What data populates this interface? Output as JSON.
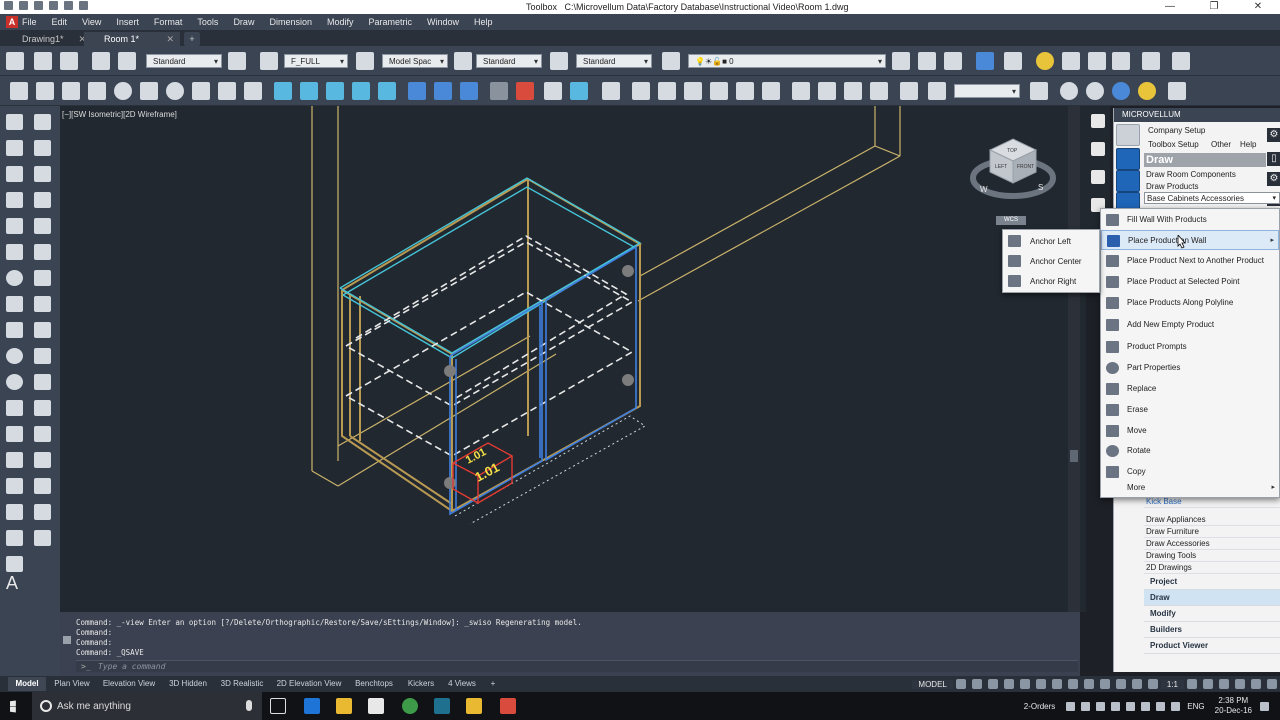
{
  "window": {
    "app_name": "Toolbox",
    "file_path": "C:\\Microvellum Data\\Factory Database\\Instructional Video\\Room 1.dwg"
  },
  "menu": [
    "File",
    "Edit",
    "View",
    "Insert",
    "Format",
    "Tools",
    "Draw",
    "Dimension",
    "Modify",
    "Parametric",
    "Window",
    "Help"
  ],
  "doc_tabs": [
    {
      "label": "Drawing1*",
      "active": false
    },
    {
      "label": "Room 1*",
      "active": true
    }
  ],
  "toolbar": {
    "text_style": "Standard",
    "font": "F_FULL",
    "dim_style": "Model Spac",
    "table_style": "Standard",
    "mleader_style": "Standard",
    "layer": "0"
  },
  "viewport": {
    "label": "[−][SW Isometric][2D Wireframe]",
    "annotation_1": "1.01",
    "annotation_2": "1.01",
    "cube_top": "TOP",
    "cube_left": "LEFT",
    "cube_front": "FRONT",
    "compass_w": "W",
    "compass_s": "S",
    "wcs": "WCS"
  },
  "command": {
    "lines": [
      "Command: _-view Enter an option [?/Delete/Orthographic/Restore/Save/sEttings/Window]: _swiso Regenerating model.",
      "Command:",
      "Command:",
      "Command: _QSAVE"
    ],
    "placeholder": "Type a command"
  },
  "layout_tabs": [
    "Model",
    "Plan View",
    "Elevation View",
    "3D Hidden",
    "3D Realistic",
    "2D Elevation View",
    "Benchtops",
    "Kickers",
    "4 Views"
  ],
  "status": {
    "mode": "MODEL",
    "scale": "1:1"
  },
  "palette": {
    "header": "MICROVELLUM",
    "company_setup": "Company Setup",
    "toolbox_setup": "Toolbox Setup",
    "other": "Other",
    "help": "Help",
    "draw": "Draw",
    "draw_room_components": "Draw Room Components",
    "draw_products": "Draw Products",
    "category": "Base Cabinets Accessories",
    "list": [
      "Kick Base",
      "Draw Appliances",
      "Draw Furniture",
      "Draw Accessories",
      "Drawing Tools",
      "2D Drawings"
    ],
    "sections": [
      "Project",
      "Draw",
      "Modify",
      "Builders",
      "Product Viewer"
    ],
    "selected_section": "Draw"
  },
  "context_menu": [
    {
      "label": "Fill Wall With Products",
      "icon": "grid-icon"
    },
    {
      "label": "Place Product on Wall",
      "icon": "wall-icon",
      "submenu": true,
      "highlighted": true
    },
    {
      "label": "Place Product Next to Another Product",
      "icon": "product-next-icon"
    },
    {
      "label": "Place Product at Selected Point",
      "icon": "crosshair-icon"
    },
    {
      "label": "Place Products Along Polyline",
      "icon": "polyline-icon"
    },
    {
      "label": "Add New Empty Product",
      "icon": "plus-icon"
    },
    {
      "label": "Product Prompts",
      "icon": "document-icon"
    },
    {
      "label": "Part Properties",
      "icon": "gear-icon"
    },
    {
      "label": "Replace",
      "icon": "replace-icon"
    },
    {
      "label": "Erase",
      "icon": "eraser-icon"
    },
    {
      "label": "Move",
      "icon": "move-icon"
    },
    {
      "label": "Rotate",
      "icon": "rotate-icon"
    },
    {
      "label": "Copy",
      "icon": "copy-icon"
    },
    {
      "label": "More",
      "icon": "",
      "submenu": true
    }
  ],
  "submenu": [
    "Anchor Left",
    "Anchor Center",
    "Anchor Right"
  ],
  "taskbar": {
    "search_placeholder": "Ask me anything",
    "orders": "2-Orders",
    "language": "ENG",
    "time": "2:38 PM",
    "date": "20-Dec-16"
  }
}
